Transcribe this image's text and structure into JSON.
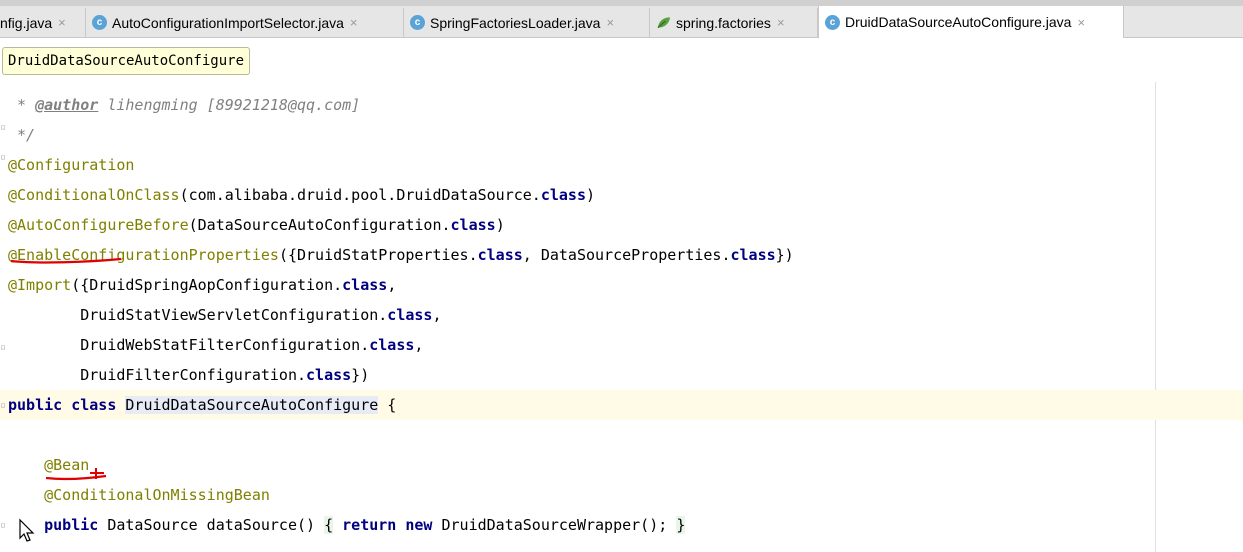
{
  "tabs": [
    {
      "label": "nfig.java",
      "icon": "none",
      "active": false
    },
    {
      "label": "AutoConfigurationImportSelector.java",
      "icon": "class-icon",
      "active": false
    },
    {
      "label": "SpringFactoriesLoader.java",
      "icon": "class-icon",
      "active": false
    },
    {
      "label": "spring.factories",
      "icon": "leaf-icon",
      "active": false
    },
    {
      "label": "DruidDataSourceAutoConfigure.java",
      "icon": "class-icon",
      "active": true
    }
  ],
  "breadcrumb": "DruidDataSourceAutoConfigure",
  "code": {
    "l1": {
      "star": " * ",
      "tag": "@author",
      "rest": " lihengming [89921218@qq.com]"
    },
    "l2": " */",
    "l3": "@Configuration",
    "l4": {
      "ann": "@ConditionalOnClass",
      "a": "(com.alibaba.druid.pool.DruidDataSource.",
      "kw": "class",
      "b": ")"
    },
    "l5": {
      "ann": "@AutoConfigureBefore",
      "a": "(DataSourceAutoConfiguration.",
      "kw": "class",
      "b": ")"
    },
    "l6": {
      "ann": "@EnableConfigurationProperties",
      "a": "({DruidStatProperties.",
      "kw1": "class",
      "b": ", DataSourceProperties.",
      "kw2": "class",
      "c": "})"
    },
    "l7": {
      "ann": "@Import",
      "a": "({DruidSpringAopConfiguration.",
      "kw": "class",
      "b": ","
    },
    "l8": {
      "a": "        DruidStatViewServletConfiguration.",
      "kw": "class",
      "b": ","
    },
    "l9": {
      "a": "        DruidWebStatFilterConfiguration.",
      "kw": "class",
      "b": ","
    },
    "l10": {
      "a": "        DruidFilterConfiguration.",
      "kw": "class",
      "b": "})"
    },
    "l11": {
      "kw1": "public",
      "kw2": "class",
      "name": "DruidDataSourceAutoConfigure",
      "b": " {"
    },
    "l13": "    @Bean",
    "l14": "    @ConditionalOnMissingBean",
    "l15": {
      "kw1": "public",
      "a": " DataSource dataSource() ",
      "open": "{",
      "kw2": "return",
      "kw3": "new",
      "b": " DruidDataSourceWrapper(); ",
      "close": "}"
    }
  }
}
